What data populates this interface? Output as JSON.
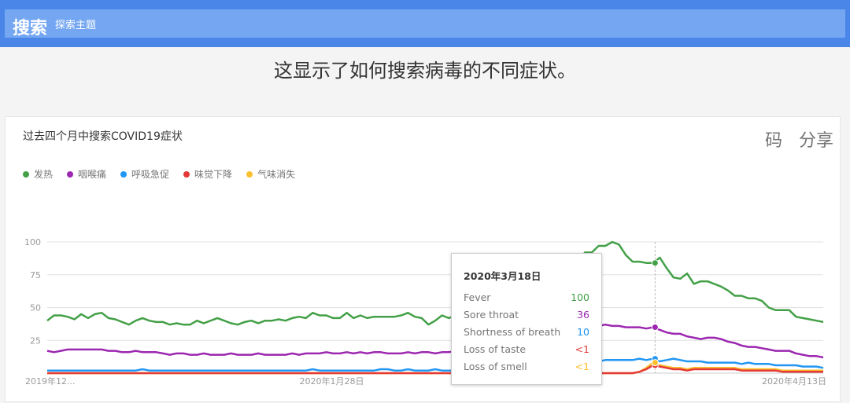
{
  "header": {
    "brand": "搜索",
    "subtitle": "探索主题"
  },
  "headline": "这显示了如何搜索病毒的不同症状。",
  "card": {
    "title": "过去四个月中搜索COVID19症状",
    "actions": [
      "码",
      "分享"
    ]
  },
  "legend": [
    {
      "label": "发热",
      "color": "#43a047"
    },
    {
      "label": "咽喉痛",
      "color": "#9c27b0"
    },
    {
      "label": "呼吸急促",
      "color": "#2196f3"
    },
    {
      "label": "味觉下降",
      "color": "#e53935"
    },
    {
      "label": "气味消失",
      "color": "#fbc02d"
    }
  ],
  "tooltip": {
    "date": "2020年3月18日",
    "rows": [
      {
        "label": "Fever",
        "value": "100",
        "color": "#43a047"
      },
      {
        "label": "Sore throat",
        "value": "36",
        "color": "#9c27b0"
      },
      {
        "label": "Shortness of breath",
        "value": "10",
        "color": "#2196f3"
      },
      {
        "label": "Loss of taste",
        "value": "<1",
        "color": "#e53935"
      },
      {
        "label": "Loss of smell",
        "value": "<1",
        "color": "#fbc02d"
      }
    ]
  },
  "chart_data": {
    "type": "line",
    "ylim": [
      0,
      100
    ],
    "yticks": [
      25,
      50,
      75,
      100
    ],
    "grid": true,
    "legend_position": "top-left",
    "xtick_labels": [
      "2019年12...",
      "2020年1月28日",
      "2020年4月13日"
    ],
    "x_start": "2019-12-15",
    "x_end": "2020-04-13",
    "highlight_date": "2020-03-18",
    "series": [
      {
        "name": "发热",
        "color": "#43a047",
        "values": [
          40,
          44,
          44,
          43,
          41,
          45,
          42,
          45,
          46,
          42,
          41,
          39,
          37,
          40,
          42,
          40,
          39,
          39,
          37,
          38,
          37,
          37,
          40,
          38,
          40,
          42,
          40,
          38,
          37,
          39,
          40,
          38,
          40,
          40,
          41,
          40,
          42,
          43,
          42,
          46,
          44,
          44,
          42,
          42,
          46,
          42,
          44,
          42,
          43,
          43,
          43,
          43,
          44,
          46,
          43,
          42,
          37,
          40,
          44,
          42,
          44,
          40,
          37,
          40,
          41,
          40,
          40,
          40,
          40,
          41,
          42,
          44,
          44,
          50,
          55,
          60,
          70,
          78,
          85,
          92,
          92,
          97,
          97,
          100,
          98,
          90,
          85,
          85,
          84,
          84,
          88,
          80,
          73,
          72,
          76,
          68,
          70,
          70,
          68,
          66,
          63,
          59,
          59,
          57,
          57,
          55,
          50,
          48,
          48,
          48,
          43,
          42,
          41,
          40,
          39
        ]
      },
      {
        "name": "咽喉痛",
        "color": "#9c27b0",
        "values": [
          17,
          16,
          17,
          18,
          18,
          18,
          18,
          18,
          18,
          17,
          17,
          16,
          16,
          17,
          16,
          16,
          16,
          15,
          14,
          15,
          15,
          14,
          14,
          15,
          14,
          14,
          14,
          15,
          14,
          14,
          14,
          15,
          14,
          14,
          14,
          14,
          15,
          14,
          15,
          15,
          15,
          16,
          15,
          15,
          16,
          15,
          16,
          15,
          16,
          16,
          15,
          15,
          15,
          16,
          15,
          16,
          16,
          15,
          16,
          16,
          17,
          15,
          16,
          15,
          15,
          16,
          16,
          17,
          18,
          19,
          21,
          22,
          24,
          27,
          30,
          32,
          34,
          35,
          35,
          36,
          36,
          36,
          37,
          36,
          36,
          35,
          35,
          35,
          34,
          35,
          33,
          31,
          30,
          30,
          28,
          27,
          26,
          27,
          27,
          26,
          24,
          23,
          21,
          20,
          20,
          19,
          18,
          17,
          17,
          17,
          15,
          14,
          13,
          13,
          12
        ]
      },
      {
        "name": "呼吸急促",
        "color": "#2196f3",
        "values": [
          2,
          2,
          2,
          2,
          2,
          2,
          2,
          2,
          2,
          2,
          2,
          2,
          2,
          2,
          3,
          2,
          2,
          2,
          2,
          2,
          2,
          2,
          2,
          2,
          2,
          2,
          2,
          2,
          2,
          2,
          2,
          2,
          2,
          2,
          2,
          2,
          2,
          2,
          2,
          3,
          2,
          2,
          2,
          2,
          2,
          2,
          2,
          2,
          2,
          3,
          3,
          2,
          2,
          3,
          2,
          2,
          2,
          3,
          2,
          2,
          2,
          3,
          2,
          3,
          3,
          3,
          3,
          3,
          3,
          3,
          3,
          3,
          3,
          4,
          4,
          5,
          5,
          6,
          7,
          8,
          9,
          9,
          10,
          10,
          10,
          10,
          10,
          11,
          10,
          11,
          9,
          10,
          11,
          10,
          9,
          9,
          9,
          8,
          8,
          8,
          8,
          8,
          7,
          8,
          7,
          7,
          7,
          6,
          6,
          6,
          6,
          5,
          5,
          5,
          4
        ]
      },
      {
        "name": "味觉下降",
        "color": "#e53935",
        "values": [
          0,
          0,
          0,
          0,
          0,
          0,
          0,
          0,
          0,
          0,
          0,
          0,
          0,
          0,
          0,
          0,
          0,
          0,
          0,
          0,
          0,
          0,
          0,
          0,
          0,
          0,
          0,
          0,
          0,
          0,
          0,
          0,
          0,
          0,
          0,
          0,
          0,
          0,
          0,
          0,
          0,
          0,
          0,
          0,
          0,
          0,
          0,
          0,
          0,
          0,
          0,
          0,
          0,
          0,
          0,
          0,
          0,
          0,
          0,
          0,
          0,
          0,
          0,
          0,
          0,
          0,
          0,
          0,
          0,
          0,
          0,
          0,
          0,
          0,
          0,
          0,
          0,
          0,
          0,
          0,
          0,
          0,
          0,
          0,
          0,
          0,
          0,
          1,
          3,
          6,
          5,
          4,
          3,
          3,
          2,
          3,
          3,
          3,
          3,
          3,
          3,
          3,
          2,
          2,
          2,
          2,
          2,
          2,
          1,
          1,
          1,
          1,
          1,
          1,
          1
        ]
      },
      {
        "name": "气味消失",
        "color": "#fbc02d",
        "values": [
          0,
          0,
          0,
          0,
          0,
          0,
          0,
          0,
          0,
          0,
          0,
          0,
          0,
          0,
          0,
          0,
          0,
          0,
          0,
          0,
          0,
          0,
          0,
          0,
          0,
          0,
          0,
          0,
          0,
          0,
          0,
          0,
          0,
          0,
          0,
          0,
          0,
          0,
          0,
          0,
          0,
          0,
          0,
          0,
          0,
          0,
          0,
          0,
          0,
          0,
          0,
          0,
          0,
          0,
          0,
          0,
          0,
          0,
          0,
          0,
          0,
          0,
          0,
          0,
          0,
          0,
          0,
          0,
          0,
          0,
          0,
          0,
          0,
          0,
          0,
          0,
          0,
          0,
          0,
          0,
          0,
          0,
          0,
          0,
          0,
          0,
          0,
          1,
          4,
          8,
          6,
          5,
          4,
          4,
          3,
          4,
          4,
          4,
          4,
          4,
          4,
          4,
          3,
          3,
          3,
          3,
          3,
          3,
          2,
          2,
          2,
          2,
          2,
          2,
          2
        ]
      }
    ]
  }
}
